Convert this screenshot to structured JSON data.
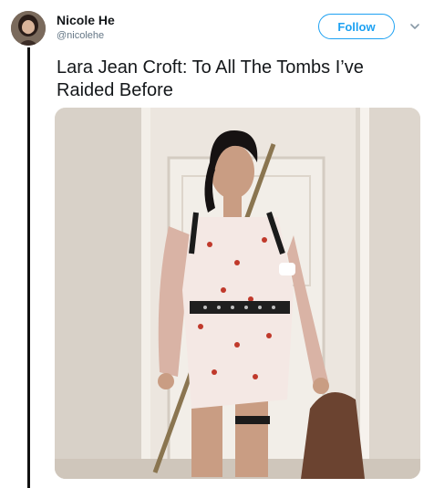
{
  "tweet": {
    "author": {
      "display_name": "Nicole He",
      "handle": "@nicolehe",
      "avatar_icon": "profile-avatar"
    },
    "follow_label": "Follow",
    "menu_icon": "chevron-down-icon",
    "text": "Lara Jean Croft: To All The Tombs I’ve Raided Before",
    "photo": {
      "subject": "woman in floral dress with cardigan, belts, thigh straps and a staff, standing in a hallway"
    }
  },
  "colors": {
    "accent": "#1da1f2",
    "text": "#14171a",
    "secondary_text": "#657786",
    "thread_line": "#111111"
  }
}
